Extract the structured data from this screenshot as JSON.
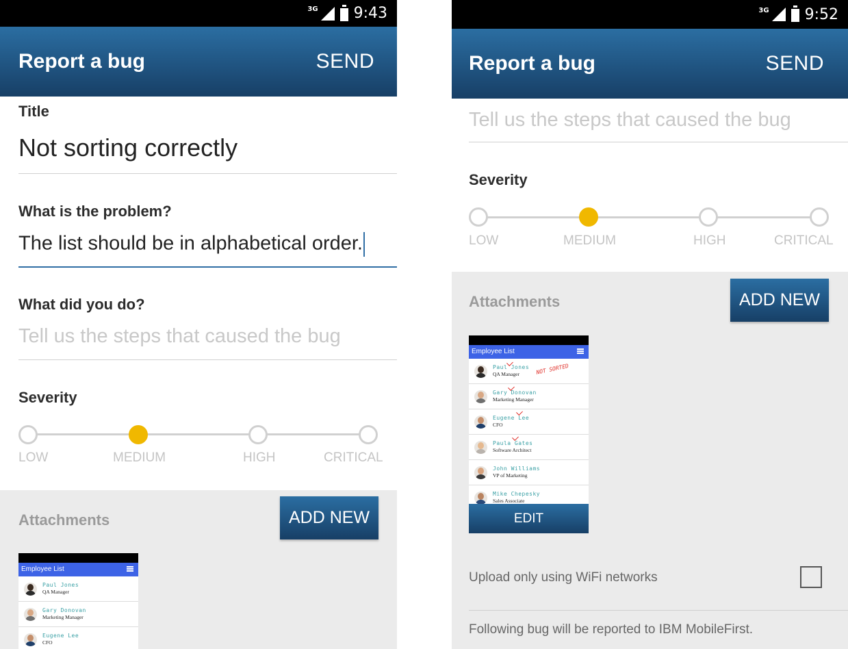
{
  "left": {
    "status": {
      "network": "3G",
      "time": "9:43"
    },
    "appbar": {
      "title": "Report a bug",
      "send_label": "SEND"
    },
    "form": {
      "title_label": "Title",
      "title_value": "Not sorting correctly",
      "problem_label": "What is the problem?",
      "problem_value": "The list should be in alphabetical order.",
      "steps_label": "What did you do?",
      "steps_placeholder": "Tell us the steps that caused the bug",
      "severity_label": "Severity"
    },
    "severity": {
      "levels": [
        "LOW",
        "MEDIUM",
        "HIGH",
        "CRITICAL"
      ],
      "selected": "MEDIUM",
      "selected_color": "#f0b800"
    },
    "attachments": {
      "title": "Attachments",
      "add_label": "ADD NEW",
      "thumbnail": {
        "header": "Employee List",
        "rows": [
          {
            "name": "Paul Jones",
            "role": "QA Manager"
          },
          {
            "name": "Gary Donovan",
            "role": "Marketing Manager"
          },
          {
            "name": "Eugene Lee",
            "role": "CFO"
          }
        ]
      }
    }
  },
  "right": {
    "status": {
      "network": "3G",
      "time": "9:52"
    },
    "appbar": {
      "title": "Report a bug",
      "send_label": "SEND"
    },
    "form": {
      "steps_placeholder": "Tell us the steps that caused the bug",
      "severity_label": "Severity"
    },
    "severity": {
      "levels": [
        "LOW",
        "MEDIUM",
        "HIGH",
        "CRITICAL"
      ],
      "selected": "MEDIUM"
    },
    "attachments": {
      "title": "Attachments",
      "add_label": "ADD NEW",
      "thumbnail": {
        "header": "Employee List",
        "annotation": "NOT SORTED",
        "rows": [
          {
            "name": "Paul Jones",
            "role": "QA Manager"
          },
          {
            "name": "Gary Donovan",
            "role": "Marketing Manager"
          },
          {
            "name": "Eugene Lee",
            "role": "CFO"
          },
          {
            "name": "Paula Gates",
            "role": "Software Architect"
          },
          {
            "name": "John Williams",
            "role": "VP of Marketing"
          },
          {
            "name": "Mike Chepesky",
            "role": "Sales Associate"
          }
        ],
        "edit_label": "EDIT"
      }
    },
    "wifi_label": "Upload only using WiFi networks",
    "wifi_checked": false,
    "footer": "Following bug will be reported to IBM MobileFirst."
  },
  "colors": {
    "appbar_top": "#2b6ea2",
    "appbar_bottom": "#173f66",
    "accent_blue": "#2f6ea5",
    "severity_selected": "#f0b800",
    "thumbnail_header": "#3d63e6"
  }
}
